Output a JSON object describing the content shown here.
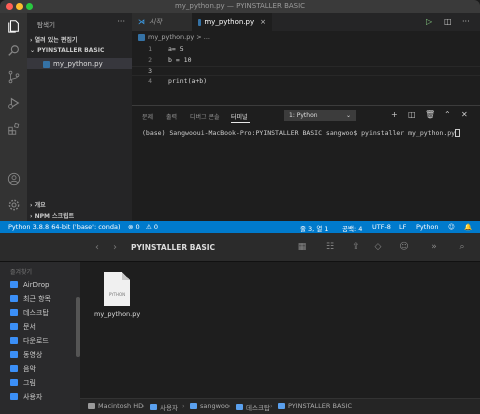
{
  "vscode": {
    "window_title": "my_python.py — PYINSTALLER BASIC",
    "explorer_title": "탐색기",
    "open_editors": "열려 있는 편집기",
    "folder_name": "PYINSTALLER BASIC",
    "file_name": "my_python.py",
    "outline": "개요",
    "npm_scripts": "NPM 스크립트",
    "tabs": {
      "welcome": "시작",
      "active": "my_python.py",
      "close": "×"
    },
    "breadcrumb": "my_python.py > ...",
    "code_lines": [
      {
        "num": "1",
        "text": "a= 5"
      },
      {
        "num": "2",
        "text": "b = 10"
      },
      {
        "num": "3",
        "text": ""
      },
      {
        "num": "4",
        "text": "print(a+b)"
      }
    ],
    "panel": {
      "tabs": [
        "문제",
        "출력",
        "디버그 콘솔",
        "터미널"
      ],
      "terminal_select": "1: Python",
      "terminal_line": "(base) Sangwooui-MacBook-Pro:PYINSTALLER BASIC sangwoo$ pyinstaller my_python.py"
    },
    "status": {
      "interpreter": "Python 3.8.8 64-bit ('base': conda)",
      "errors": "⊗ 0",
      "warnings": "⚠ 0",
      "position": "줄 3, 열 1",
      "spaces": "공백: 4",
      "encoding": "UTF-8",
      "eol": "LF",
      "language": "Python"
    }
  },
  "finder": {
    "title": "PYINSTALLER BASIC",
    "sidebar_section": "즐겨찾기",
    "sidebar_items": [
      "AirDrop",
      "최근 항목",
      "데스크탑",
      "문서",
      "다운로드",
      "동영상",
      "음악",
      "그림",
      "사용자"
    ],
    "file_icon_label": "PYTHON",
    "file_name": "my_python.py",
    "path": [
      "Macintosh HD",
      "사용자",
      "sangwoo",
      "데스크탑",
      "PYINSTALLER BASIC"
    ]
  },
  "colors": {
    "status_bar": "#007acc",
    "accent_folder": "#3b8ff7",
    "python_badge": "#3572a5"
  }
}
